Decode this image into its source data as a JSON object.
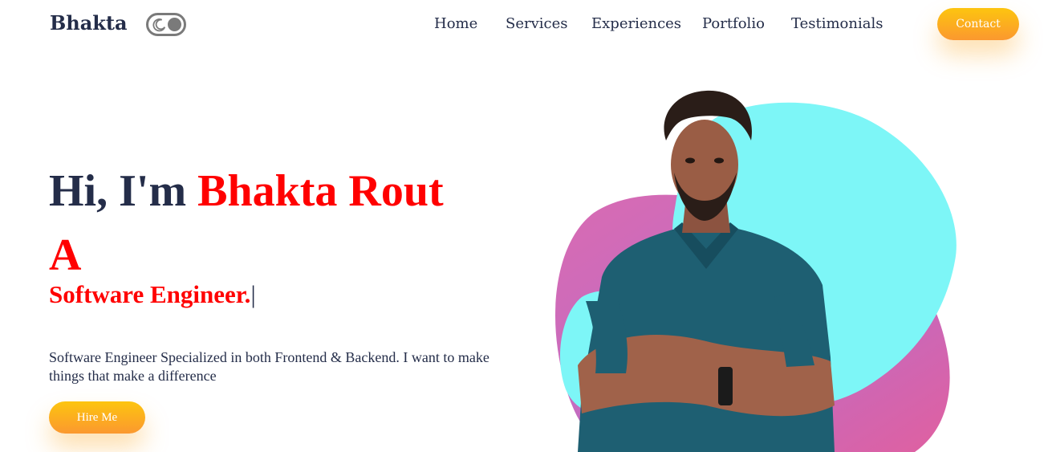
{
  "nav": {
    "brand": "Bhakta",
    "links": [
      "Home",
      "Services",
      "Experiences",
      "Portfolio",
      "Testimonials"
    ],
    "contact_label": "Contact"
  },
  "hero": {
    "greeting": "Hi, I'm ",
    "name": "Bhakta Rout",
    "article": "A",
    "role": "Software Engineer.",
    "cursor": "|",
    "description": "Software Engineer Specialized in both Frontend & Backend. I want to make things that make a difference",
    "cta_label": "Hire Me"
  },
  "colors": {
    "text": "#242d49",
    "accent_red": "#ff0000",
    "button_gradient_top": "#fdc50f",
    "button_gradient_bottom": "#fb982f",
    "blob_cyan": "#7df6f7",
    "blob_pink": "#e06aa8",
    "blob_purple": "#9b6fd3"
  },
  "icons": {
    "theme_toggle": "moon-icon"
  }
}
